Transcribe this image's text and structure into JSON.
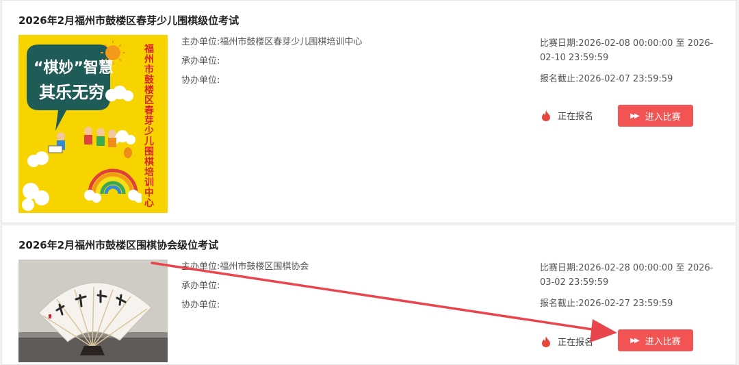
{
  "colors": {
    "accent": "#f25353",
    "poster_yellow": "#f7d400"
  },
  "competitions": [
    {
      "title": "2026年2月福州市鼓楼区春芽少儿围棋级位考试",
      "organizer": "主办单位:福州市鼓楼区春芽少儿围棋培训中心",
      "undertaker": "承办单位:",
      "co_organizer": "协办单位:",
      "date": "比赛日期:2026-02-08 00:00:00 至 2026-02-10 23:59:59",
      "deadline": "报名截止:2026-02-07 23:59:59",
      "status": "正在报名",
      "button": "进入比赛",
      "poster": {
        "slogan_line1": "“棋妙”智慧",
        "slogan_line2": "其乐无穷",
        "vertical_text": "福州市鼓楼区春芽少儿围棋培训中心"
      }
    },
    {
      "title": "2026年2月福州市鼓楼区围棋协会级位考试",
      "organizer": "主办单位:福州市鼓楼区围棋协会",
      "undertaker": "承办单位:",
      "co_organizer": "协办单位:",
      "date": "比赛日期:2026-02-28 00:00:00 至 2026-03-02 23:59:59",
      "deadline": "报名截止:2026-02-27 23:59:59",
      "status": "正在报名",
      "button": "进入比赛"
    }
  ],
  "icons": {
    "status": "flame-icon",
    "button": "fast-forward-icon"
  }
}
